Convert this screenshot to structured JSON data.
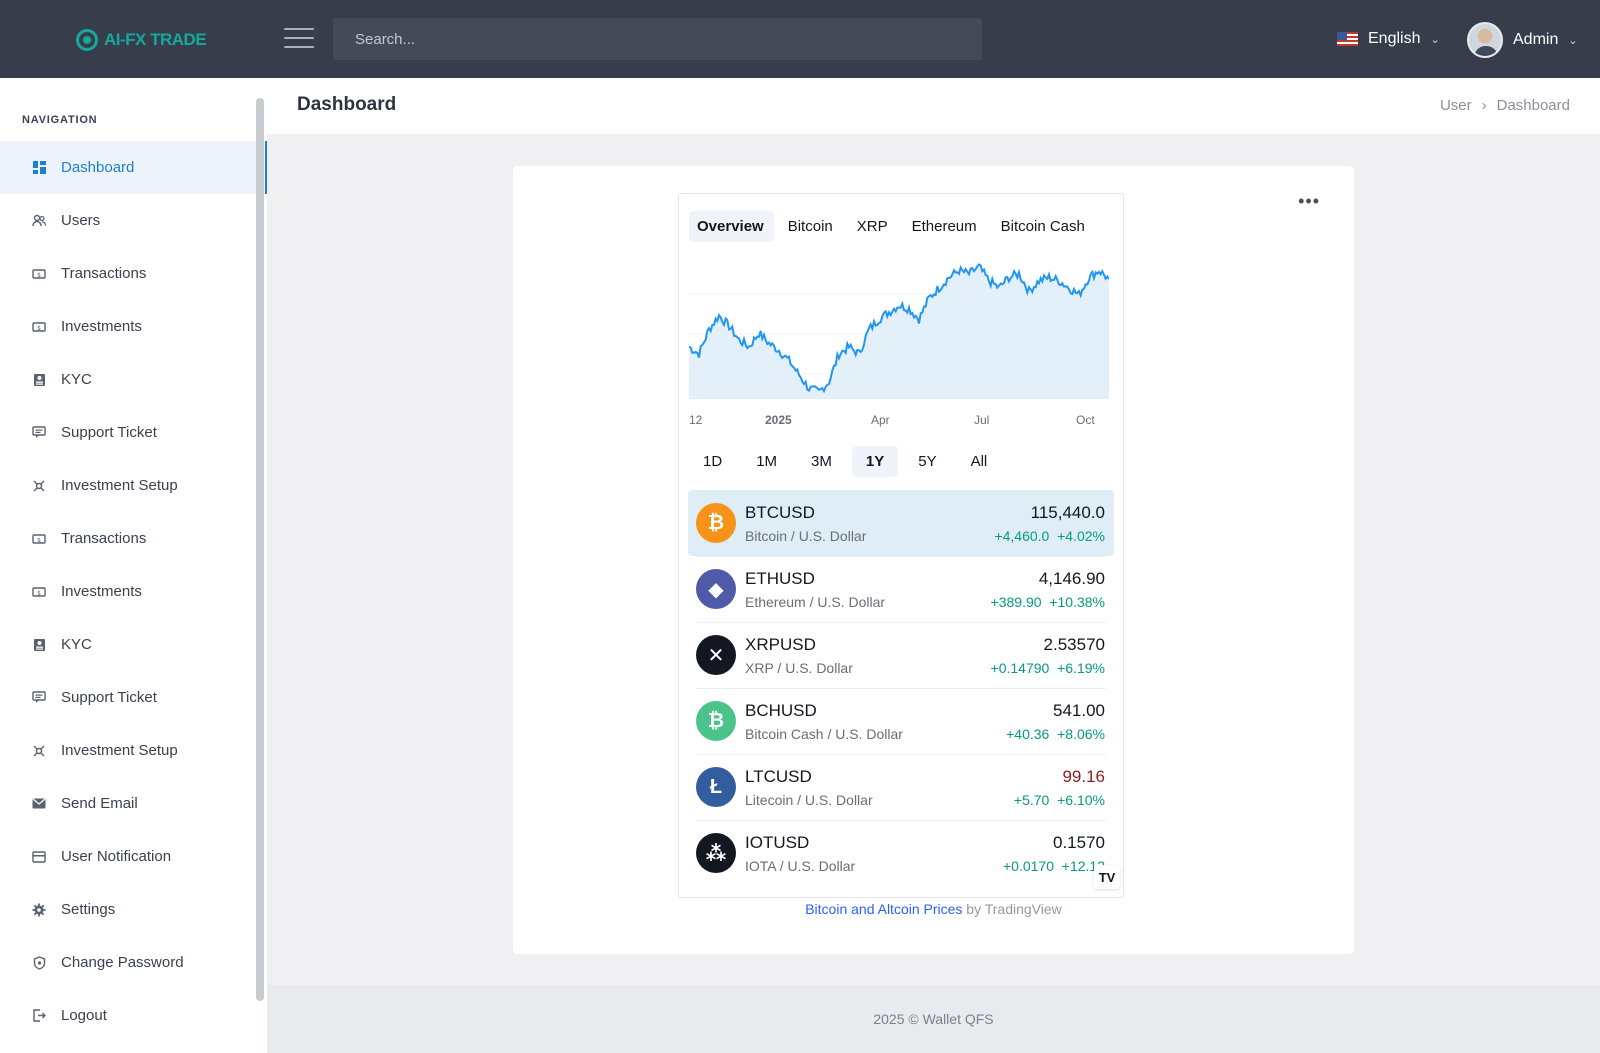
{
  "brand": {
    "logo_text": "AI-FX TRADE"
  },
  "topbar": {
    "search_placeholder": "Search...",
    "language": "English",
    "user_name": "Admin"
  },
  "sidebar": {
    "section_title": "NAVIGATION",
    "items": [
      {
        "label": "Dashboard",
        "icon": "dashboard-icon",
        "active": true
      },
      {
        "label": "Users",
        "icon": "users-icon"
      },
      {
        "label": "Transactions",
        "icon": "money-icon"
      },
      {
        "label": "Investments",
        "icon": "money-icon"
      },
      {
        "label": "KYC",
        "icon": "id-card-icon"
      },
      {
        "label": "Support Ticket",
        "icon": "chat-icon"
      },
      {
        "label": "Investment Setup",
        "icon": "setup-icon"
      },
      {
        "label": "Transactions",
        "icon": "money-icon"
      },
      {
        "label": "Investments",
        "icon": "money-icon"
      },
      {
        "label": "KYC",
        "icon": "id-card-icon"
      },
      {
        "label": "Support Ticket",
        "icon": "chat-icon"
      },
      {
        "label": "Investment Setup",
        "icon": "setup-icon"
      },
      {
        "label": "Send Email",
        "icon": "envelope-icon"
      },
      {
        "label": "User Notification",
        "icon": "notification-icon"
      },
      {
        "label": "Settings",
        "icon": "gear-icon"
      },
      {
        "label": "Change Password",
        "icon": "shield-icon"
      },
      {
        "label": "Logout",
        "icon": "logout-icon"
      }
    ]
  },
  "page": {
    "title": "Dashboard",
    "breadcrumb": [
      "User",
      "Dashboard"
    ]
  },
  "widget": {
    "tabs": [
      "Overview",
      "Bitcoin",
      "XRP",
      "Ethereum",
      "Bitcoin Cash"
    ],
    "active_tab": "Overview",
    "x_axis_labels": [
      "12",
      "2025",
      "Apr",
      "Jul",
      "Oct"
    ],
    "ranges": [
      "1D",
      "1M",
      "3M",
      "1Y",
      "5Y",
      "All"
    ],
    "active_range": "1Y",
    "line_color": "#2196f3",
    "area_color": "#e3f0fa",
    "symbols": [
      {
        "symbol": "BTCUSD",
        "name": "Bitcoin / U.S. Dollar",
        "price": "115,440.0",
        "change": "+4,460.0",
        "change_pct": "+4.02%",
        "color": "#f7931a",
        "glyph": "₿",
        "active": true
      },
      {
        "symbol": "ETHUSD",
        "name": "Ethereum / U.S. Dollar",
        "price": "4,146.90",
        "change": "+389.90",
        "change_pct": "+10.38%",
        "color": "#4f5aa8",
        "glyph": "◆"
      },
      {
        "symbol": "XRPUSD",
        "name": "XRP / U.S. Dollar",
        "price": "2.53570",
        "change": "+0.14790",
        "change_pct": "+6.19%",
        "color": "#131722",
        "glyph": "✕"
      },
      {
        "symbol": "BCHUSD",
        "name": "Bitcoin Cash / U.S. Dollar",
        "price": "541.00",
        "change": "+40.36",
        "change_pct": "+8.06%",
        "color": "#4cc38a",
        "glyph": "₿"
      },
      {
        "symbol": "LTCUSD",
        "name": "Litecoin / U.S. Dollar",
        "price": "99.16",
        "change": "+5.70",
        "change_pct": "+6.10%",
        "color": "#345d9d",
        "glyph": "Ł",
        "price_down": true
      },
      {
        "symbol": "IOTUSD",
        "name": "IOTA / U.S. Dollar",
        "price": "0.1570",
        "change": "+0.0170",
        "change_pct": "+12.12",
        "color": "#131722",
        "glyph": "⁂"
      }
    ],
    "tv_badge": "TV"
  },
  "chart_data": {
    "type": "area",
    "title": "",
    "xlabel": "",
    "ylabel": "",
    "x_ticks": [
      "12",
      "2025",
      "Apr",
      "Jul",
      "Oct"
    ],
    "series": [
      {
        "values": [
          96000,
          94000,
          101000,
          105000,
          102000,
          98000,
          96000,
          100000,
          97000,
          95000,
          92000,
          88000,
          84000,
          83000,
          86000,
          94000,
          96000,
          94000,
          101000,
          104000,
          106000,
          108000,
          107000,
          104000,
          110000,
          113000,
          116000,
          118000,
          117000,
          119000,
          115000,
          113000,
          116000,
          117000,
          112000,
          115000,
          116000,
          115000,
          113000,
          111000,
          116000,
          118000,
          115500
        ]
      }
    ]
  },
  "attribution": {
    "link_text": "Bitcoin and Altcoin Prices",
    "suffix": " by TradingView"
  },
  "footer": {
    "text": "2025 © Wallet QFS"
  }
}
